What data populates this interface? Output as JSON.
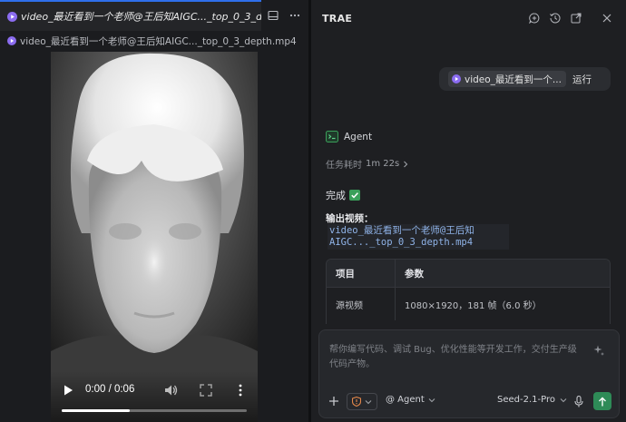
{
  "editor": {
    "tab_title": "video_最近看到一个老师@王后知AIGC..._top_0_3_depth.mp4",
    "breadcrumb": "video_最近看到一个老师@王后知AIGC..._top_0_3_depth.mp4",
    "actions": [
      "split-editor-icon",
      "more-icon"
    ]
  },
  "video": {
    "time": "0:00 / 0:06",
    "progress": 0.37
  },
  "panel": {
    "title": "TRAE",
    "header_icons": [
      "add-chat-icon",
      "history-icon",
      "open-external-icon",
      "close-icon"
    ],
    "user_message": {
      "file_chip": "video_最近看到一个...",
      "action": "运行"
    },
    "agent": {
      "name": "Agent",
      "timing_label": "任务耗时",
      "timing_value": "1m 22s",
      "status": "完成",
      "output_label": "输出视频：",
      "output_file": "video_最近看到一个老师@王后知AIGC..._top_0_3_depth.mp4",
      "table": {
        "headers": [
          "项目",
          "参数"
        ],
        "rows": [
          [
            "源视频",
            "1080×1920，181 帧（6.0 秒）"
          ]
        ]
      }
    },
    "input": {
      "placeholder": "帮你编写代码、调试 Bug、优化性能等开发工作，交付生产级代码产物。",
      "mode": "@ Agent",
      "model": "Seed-2.1-Pro"
    }
  },
  "colors": {
    "accent": "#2f6feb",
    "play_badge": "#8b6cf0",
    "send": "#2e8b57",
    "check": "#3aa05a",
    "shield": "#e5884a"
  }
}
